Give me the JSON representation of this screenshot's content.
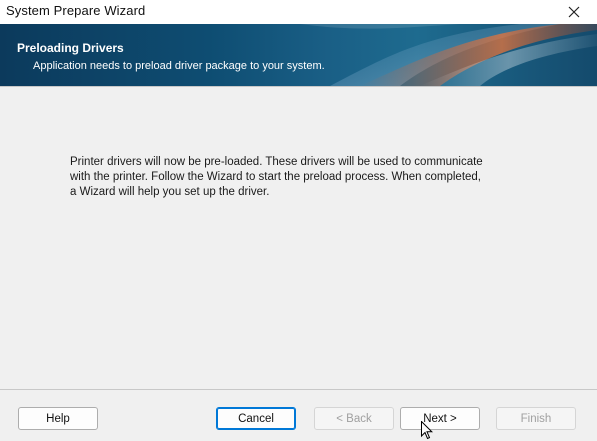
{
  "window": {
    "title": "System Prepare Wizard"
  },
  "banner": {
    "title": "Preloading Drivers",
    "subtitle": "Application needs to preload driver package to your system."
  },
  "body": {
    "message": "Printer drivers will now be pre-loaded. These drivers will be used to communicate with the printer. Follow the Wizard to start the preload process. When completed, a Wizard will help you set up the driver."
  },
  "buttons": {
    "help": "Help",
    "cancel": "Cancel",
    "back": "< Back",
    "next": "Next >",
    "finish": "Finish"
  },
  "icons": {
    "close": "close-icon"
  },
  "colors": {
    "banner": "#0e4d72",
    "accent": "#0078d7"
  }
}
